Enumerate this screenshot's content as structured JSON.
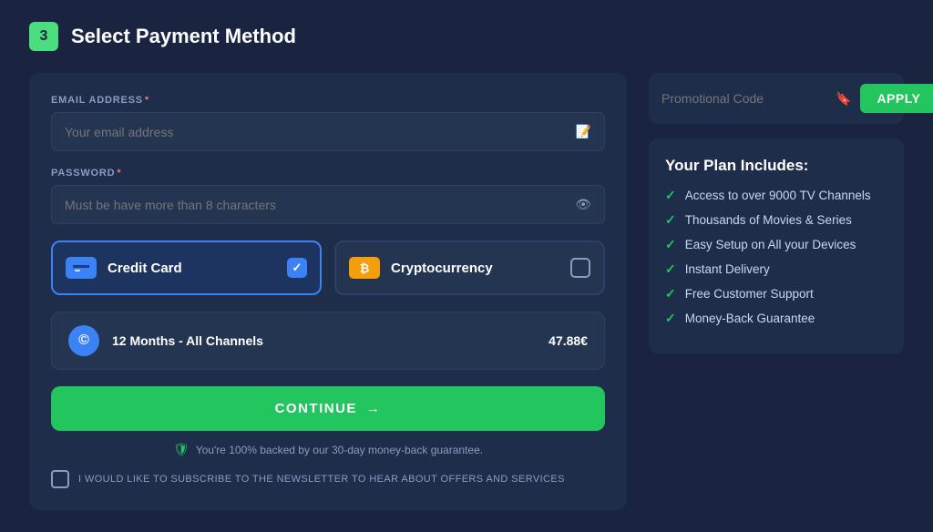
{
  "header": {
    "step_number": "3",
    "title": "Select Payment Method"
  },
  "left_panel": {
    "email_label": "EMAIL ADDRESS",
    "email_placeholder": "Your email address",
    "password_label": "PASSWORD",
    "password_placeholder": "Must be have more than 8 characters",
    "payment_methods": [
      {
        "id": "credit_card",
        "label": "Credit Card",
        "icon": "💳",
        "selected": true
      },
      {
        "id": "crypto",
        "label": "Cryptocurrency",
        "icon": "₿",
        "selected": false
      }
    ],
    "subscription": {
      "label": "12 Months - All Channels",
      "price": "47.88€",
      "icon": "©"
    },
    "continue_button": "CONTINUE",
    "continue_arrow": "→",
    "guarantee_text": "You're 100% backed by our 30-day money-back guarantee.",
    "newsletter_label": "I WOULD LIKE TO SUBSCRIBE TO THE NEWSLETTER TO HEAR ABOUT OFFERS AND SERVICES"
  },
  "right_panel": {
    "promo": {
      "placeholder": "Promotional Code",
      "apply_label": "APPLY"
    },
    "plan": {
      "title": "Your Plan Includes:",
      "items": [
        "Access to over 9000 TV Channels",
        "Thousands of Movies & Series",
        "Easy Setup on All your Devices",
        "Instant Delivery",
        "Free Customer Support",
        "Money-Back Guarantee"
      ]
    }
  },
  "colors": {
    "green": "#22c55e",
    "blue": "#3b82f6",
    "amber": "#f59e0b",
    "bg_dark": "#1a2340",
    "bg_card": "#1e2d4a",
    "bg_input": "#243552"
  }
}
